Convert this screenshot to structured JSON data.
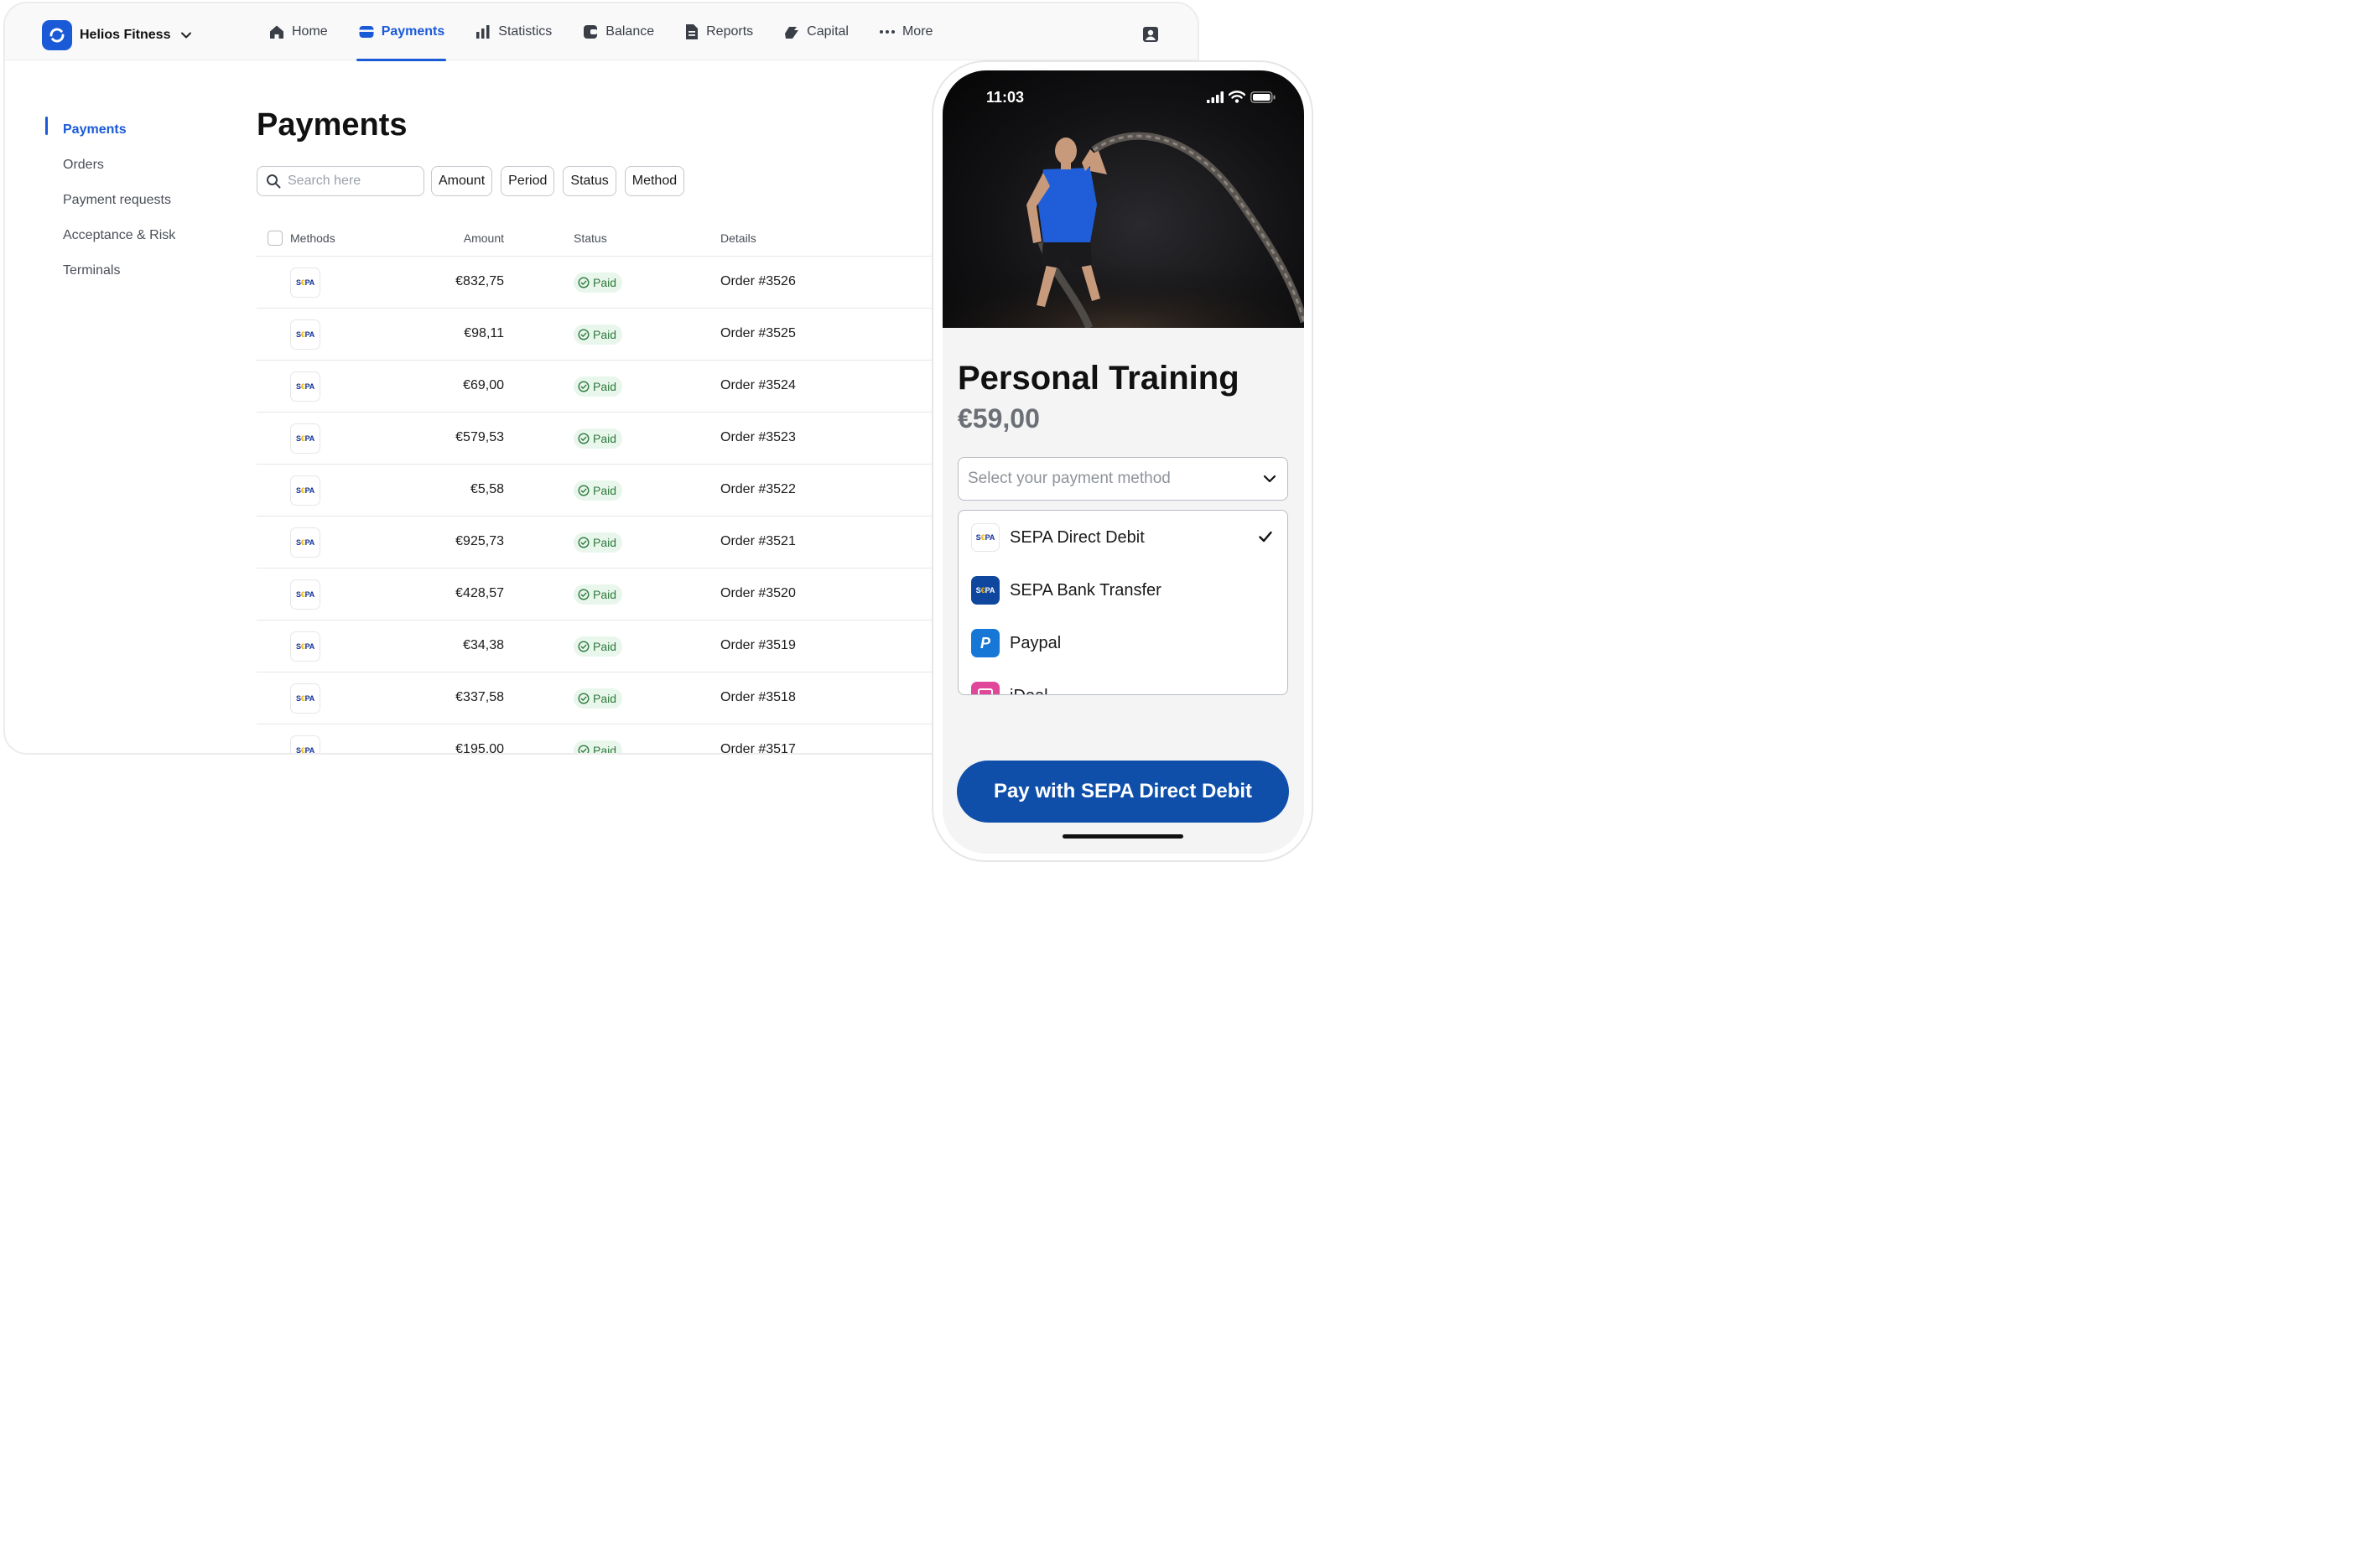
{
  "app": {
    "brand_name": "Helios Fitness"
  },
  "nav": {
    "items": [
      {
        "label": "Home",
        "icon": "home-icon"
      },
      {
        "label": "Payments",
        "icon": "payments-icon",
        "active": true
      },
      {
        "label": "Statistics",
        "icon": "bar-chart-icon"
      },
      {
        "label": "Balance",
        "icon": "balance-icon"
      },
      {
        "label": "Reports",
        "icon": "document-icon"
      },
      {
        "label": "Capital",
        "icon": "capital-icon"
      },
      {
        "label": "More",
        "icon": "more-dots-icon"
      }
    ]
  },
  "sidebar": {
    "items": [
      {
        "label": "Payments",
        "active": true
      },
      {
        "label": "Orders"
      },
      {
        "label": "Payment requests"
      },
      {
        "label": "Acceptance & Risk"
      },
      {
        "label": "Terminals"
      }
    ]
  },
  "main": {
    "title": "Payments",
    "search_placeholder": "Search here",
    "filters": [
      "Amount",
      "Period",
      "Status",
      "Method"
    ],
    "columns": {
      "methods": "Methods",
      "amount": "Amount",
      "status": "Status",
      "details": "Details"
    },
    "rows": [
      {
        "method": "SEPA",
        "amount": "€832,75",
        "status": "Paid",
        "details": "Order #3526"
      },
      {
        "method": "SEPA",
        "amount": "€98,11",
        "status": "Paid",
        "details": "Order #3525"
      },
      {
        "method": "SEPA",
        "amount": "€69,00",
        "status": "Paid",
        "details": "Order #3524"
      },
      {
        "method": "SEPA",
        "amount": "€579,53",
        "status": "Paid",
        "details": "Order #3523"
      },
      {
        "method": "SEPA",
        "amount": "€5,58",
        "status": "Paid",
        "details": "Order #3522"
      },
      {
        "method": "SEPA",
        "amount": "€925,73",
        "status": "Paid",
        "details": "Order #3521"
      },
      {
        "method": "SEPA",
        "amount": "€428,57",
        "status": "Paid",
        "details": "Order #3520"
      },
      {
        "method": "SEPA",
        "amount": "€34,38",
        "status": "Paid",
        "details": "Order #3519"
      },
      {
        "method": "SEPA",
        "amount": "€337,58",
        "status": "Paid",
        "details": "Order #3518"
      },
      {
        "method": "SEPA",
        "amount": "€195,00",
        "status": "Paid",
        "details": "Order #3517"
      }
    ]
  },
  "phone": {
    "time": "11:03",
    "product_title": "Personal Training",
    "product_price": "€59,00",
    "select_placeholder": "Select your payment method",
    "options": [
      {
        "label": "SEPA Direct Debit",
        "icon": "sepa-icon",
        "selected": true
      },
      {
        "label": "SEPA Bank Transfer",
        "icon": "sepa-bank-icon"
      },
      {
        "label": "Paypal",
        "icon": "paypal-icon"
      },
      {
        "label": "iDeal",
        "icon": "ideal-icon"
      }
    ],
    "pay_button": "Pay with SEPA Direct Debit"
  },
  "colors": {
    "accent": "#1a5ad6",
    "pay_button": "#0f4faa",
    "paid_bg": "#e9f6ec",
    "paid_text": "#2d7a3c"
  }
}
